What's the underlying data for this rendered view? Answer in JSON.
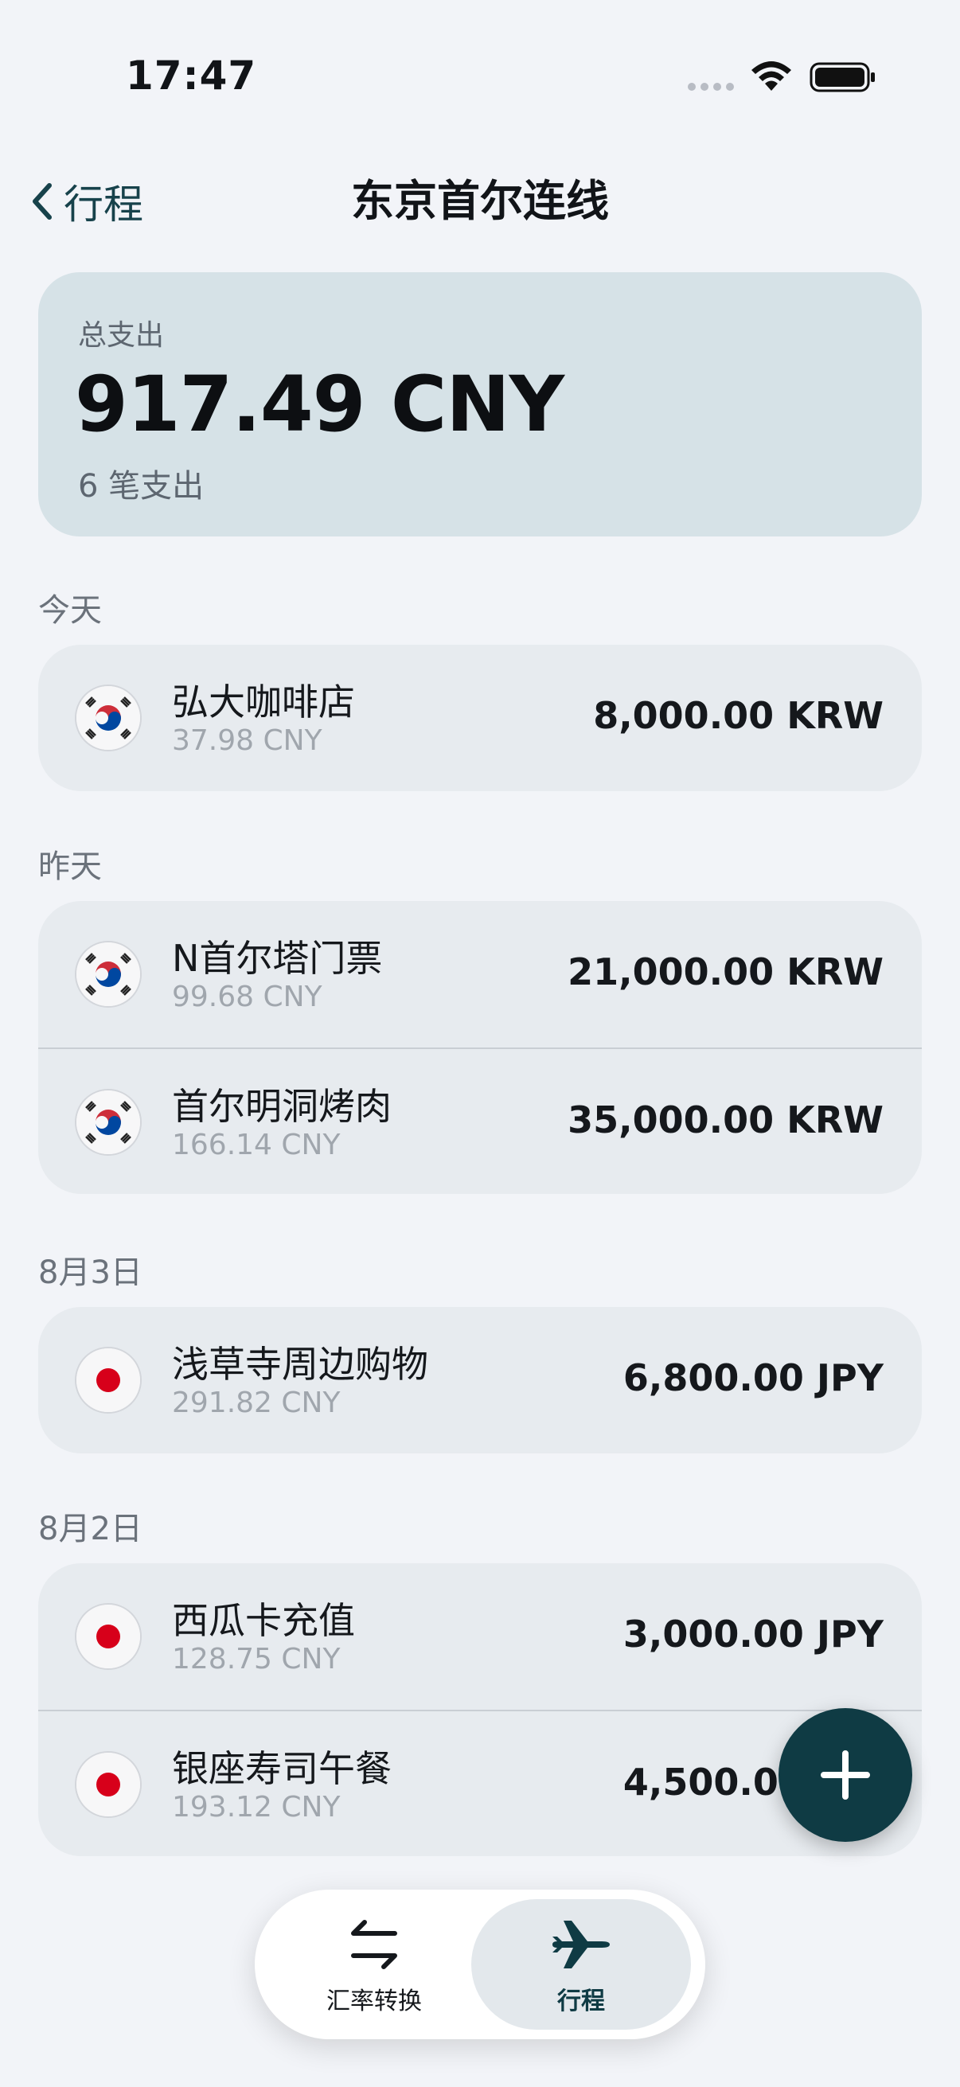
{
  "status_bar": {
    "time": "17:47"
  },
  "nav": {
    "back_label": "行程",
    "title": "东京首尔连线"
  },
  "summary": {
    "label": "总支出",
    "total": "917.49 CNY",
    "count": "6 笔支出"
  },
  "sections": [
    {
      "header": "今天",
      "items": [
        {
          "flag": "korea-flag-icon",
          "name": "弘大咖啡店",
          "converted": "37.98 CNY",
          "amount": "8,000.00 KRW"
        }
      ]
    },
    {
      "header": "昨天",
      "items": [
        {
          "flag": "korea-flag-icon",
          "name": "N首尔塔门票",
          "converted": "99.68 CNY",
          "amount": "21,000.00 KRW"
        },
        {
          "flag": "korea-flag-icon",
          "name": "首尔明洞烤肉",
          "converted": "166.14 CNY",
          "amount": "35,000.00 KRW"
        }
      ]
    },
    {
      "header": "8月3日",
      "items": [
        {
          "flag": "japan-flag-icon",
          "name": "浅草寺周边购物",
          "converted": "291.82 CNY",
          "amount": "6,800.00 JPY"
        }
      ]
    },
    {
      "header": "8月2日",
      "items": [
        {
          "flag": "japan-flag-icon",
          "name": "西瓜卡充值",
          "converted": "128.75 CNY",
          "amount": "3,000.00 JPY"
        },
        {
          "flag": "japan-flag-icon",
          "name": "银座寿司午餐",
          "converted": "193.12 CNY",
          "amount": "4,500.00 JPY"
        }
      ]
    }
  ],
  "tabs": [
    {
      "label": "汇率转换",
      "icon": "exchange-arrows-icon"
    },
    {
      "label": "行程",
      "icon": "airplane-icon",
      "selected": true
    }
  ],
  "fab": {
    "icon": "plus-icon"
  },
  "colors": {
    "accent": "#0f3b44",
    "summary_bg": "#d6e2e7",
    "row_bg": "#e7ebef",
    "page_bg": "#f2f4f8"
  }
}
